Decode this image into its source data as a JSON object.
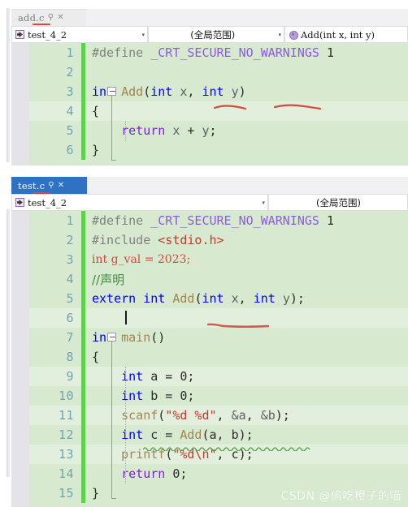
{
  "watermark": "CSDN @偷吃橙子的喵",
  "panels": [
    {
      "id": "panel-add-c",
      "tab": {
        "title": "add.c",
        "pin_icon": "pin-icon",
        "close_icon": "close-icon",
        "state": "inactive"
      },
      "nav": {
        "project": {
          "label": "test_4_2",
          "icon": "project-icon",
          "caret": "▾"
        },
        "scope": {
          "label": "(全局范围)",
          "caret": "▾"
        },
        "member": {
          "label": "Add(int x, int y)",
          "icon": "method-icon"
        }
      },
      "lines": [
        {
          "no": "1",
          "tokens": [
            {
              "t": "#define ",
              "c": "pp"
            },
            {
              "t": "_CRT_SECURE_NO_WARNINGS",
              "c": "mac"
            },
            {
              "t": " ",
              "c": "pl"
            },
            {
              "t": "1",
              "c": "num"
            }
          ]
        },
        {
          "no": "2",
          "tokens": []
        },
        {
          "no": "3",
          "tokens": [
            {
              "t": "int",
              "c": "k"
            },
            {
              "t": " ",
              "c": "pl"
            },
            {
              "t": "Add",
              "c": "fn"
            },
            {
              "t": "(",
              "c": "pl"
            },
            {
              "t": "int",
              "c": "k"
            },
            {
              "t": " ",
              "c": "pl"
            },
            {
              "t": "x",
              "c": "var"
            },
            {
              "t": ", ",
              "c": "pl"
            },
            {
              "t": "int",
              "c": "k"
            },
            {
              "t": " ",
              "c": "pl"
            },
            {
              "t": "y",
              "c": "var"
            },
            {
              "t": ")",
              "c": "pl"
            }
          ]
        },
        {
          "no": "4",
          "tokens": [
            {
              "t": "{",
              "c": "pl"
            }
          ]
        },
        {
          "no": "5",
          "tokens": [
            {
              "t": "    ",
              "c": "pl"
            },
            {
              "t": "return",
              "c": "kw2"
            },
            {
              "t": " ",
              "c": "pl"
            },
            {
              "t": "x",
              "c": "var"
            },
            {
              "t": " + ",
              "c": "pl"
            },
            {
              "t": "y",
              "c": "var"
            },
            {
              "t": ";",
              "c": "pl"
            }
          ]
        },
        {
          "no": "6",
          "tokens": [
            {
              "t": "}",
              "c": "pl"
            }
          ]
        }
      ]
    },
    {
      "id": "panel-test-c",
      "tab": {
        "title": "test.c",
        "pin_icon": "pin-icon",
        "close_icon": "close-icon",
        "state": "active"
      },
      "nav": {
        "project": {
          "label": "test_4_2",
          "icon": "project-icon",
          "caret": "▾"
        },
        "scope": {
          "label": "(全局范围)",
          "caret": "▾"
        },
        "member": {
          "label": "",
          "icon": ""
        }
      },
      "lines": [
        {
          "no": "1",
          "tokens": [
            {
              "t": "#define ",
              "c": "pp"
            },
            {
              "t": "_CRT_SECURE_NO_WARNINGS",
              "c": "mac"
            },
            {
              "t": " ",
              "c": "pl"
            },
            {
              "t": "1",
              "c": "num"
            }
          ]
        },
        {
          "no": "2",
          "tokens": [
            {
              "t": "#include ",
              "c": "pp"
            },
            {
              "t": "<stdio.h>",
              "c": "inc"
            }
          ]
        },
        {
          "no": "3",
          "tokens": [
            {
              "t": "int g_val = 2023;",
              "c": "redser"
            }
          ]
        },
        {
          "no": "4",
          "tokens": [
            {
              "t": "//声明",
              "c": "cmt cn"
            }
          ]
        },
        {
          "no": "5",
          "tokens": [
            {
              "t": "extern",
              "c": "k"
            },
            {
              "t": " ",
              "c": "pl"
            },
            {
              "t": "int",
              "c": "k"
            },
            {
              "t": " ",
              "c": "pl"
            },
            {
              "t": "Add",
              "c": "fn"
            },
            {
              "t": "(",
              "c": "pl"
            },
            {
              "t": "int",
              "c": "k"
            },
            {
              "t": " ",
              "c": "pl"
            },
            {
              "t": "x",
              "c": "var"
            },
            {
              "t": ", ",
              "c": "pl"
            },
            {
              "t": "int",
              "c": "k"
            },
            {
              "t": " ",
              "c": "pl"
            },
            {
              "t": "y",
              "c": "var"
            },
            {
              "t": ");",
              "c": "pl"
            }
          ]
        },
        {
          "no": "6",
          "tokens": []
        },
        {
          "no": "7",
          "tokens": [
            {
              "t": "int",
              "c": "k"
            },
            {
              "t": " ",
              "c": "pl"
            },
            {
              "t": "main",
              "c": "fn"
            },
            {
              "t": "()",
              "c": "pl"
            }
          ]
        },
        {
          "no": "8",
          "tokens": [
            {
              "t": "{",
              "c": "pl"
            }
          ]
        },
        {
          "no": "9",
          "tokens": [
            {
              "t": "    ",
              "c": "pl"
            },
            {
              "t": "int",
              "c": "k"
            },
            {
              "t": " a = ",
              "c": "pl"
            },
            {
              "t": "0",
              "c": "num"
            },
            {
              "t": ";",
              "c": "pl"
            }
          ]
        },
        {
          "no": "10",
          "tokens": [
            {
              "t": "    ",
              "c": "pl"
            },
            {
              "t": "int",
              "c": "k"
            },
            {
              "t": " b = ",
              "c": "pl"
            },
            {
              "t": "0",
              "c": "num"
            },
            {
              "t": ";",
              "c": "pl"
            }
          ]
        },
        {
          "no": "11",
          "tokens": [
            {
              "t": "    ",
              "c": "pl"
            },
            {
              "t": "scanf",
              "c": "fn"
            },
            {
              "t": "(",
              "c": "pl"
            },
            {
              "t": "\"%d %d\"",
              "c": "str"
            },
            {
              "t": ", ",
              "c": "pl"
            },
            {
              "t": "&a",
              "c": "var"
            },
            {
              "t": ", ",
              "c": "pl"
            },
            {
              "t": "&b",
              "c": "var"
            },
            {
              "t": ");",
              "c": "pl"
            }
          ]
        },
        {
          "no": "12",
          "tokens": [
            {
              "t": "    ",
              "c": "pl"
            },
            {
              "t": "int",
              "c": "k"
            },
            {
              "t": " c = ",
              "c": "pl"
            },
            {
              "t": "Add",
              "c": "fn"
            },
            {
              "t": "(a, b);",
              "c": "pl"
            }
          ]
        },
        {
          "no": "13",
          "tokens": [
            {
              "t": "    ",
              "c": "pl"
            },
            {
              "t": "printf",
              "c": "fn"
            },
            {
              "t": "(",
              "c": "pl"
            },
            {
              "t": "\"%d",
              "c": "str"
            },
            {
              "t": "\\n",
              "c": "esc"
            },
            {
              "t": "\"",
              "c": "str"
            },
            {
              "t": ", c);",
              "c": "pl"
            }
          ]
        },
        {
          "no": "14",
          "tokens": [
            {
              "t": "    ",
              "c": "pl"
            },
            {
              "t": "return",
              "c": "kw2"
            },
            {
              "t": " ",
              "c": "pl"
            },
            {
              "t": "0",
              "c": "num"
            },
            {
              "t": ";",
              "c": "pl"
            }
          ]
        },
        {
          "no": "15",
          "tokens": [
            {
              "t": "}",
              "c": "pl"
            }
          ]
        }
      ]
    }
  ],
  "colors": {
    "accent_tab_active": "#2f72c4",
    "editor_bg": "#d7ead0",
    "change_bar": "#5ed24a",
    "annotation_red": "#d8493f",
    "error_squiggle": "#3f8c3f"
  }
}
